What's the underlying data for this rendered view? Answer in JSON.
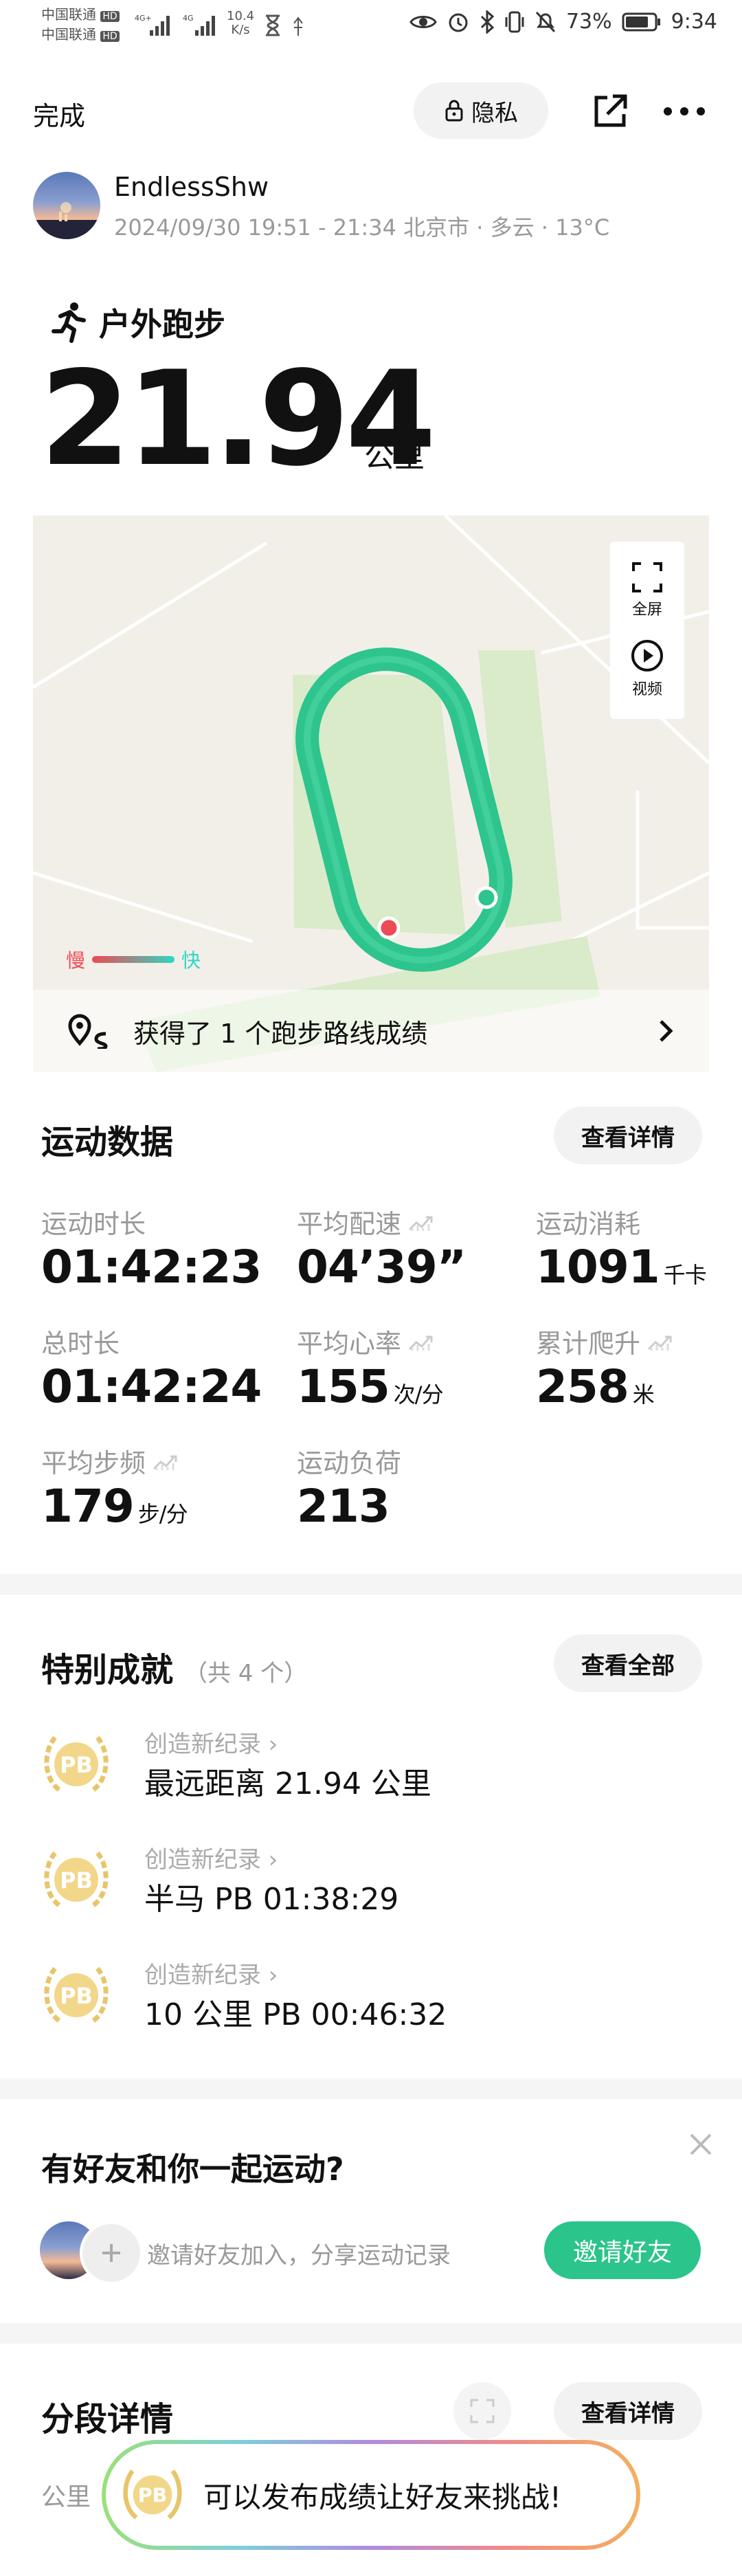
{
  "status_bar": {
    "carrier1": "中国联通",
    "carrier1_badge": "HD",
    "carrier2": "中国联通",
    "carrier2_badge": "HD",
    "net_speed": "10.4",
    "net_unit": "K/s",
    "battery": "73%",
    "time": "9:34"
  },
  "header": {
    "done_label": "完成",
    "privacy_label": "隐私"
  },
  "user": {
    "name": "EndlessShw",
    "meta": "2024/09/30 19:51 - 21:34 北京市 · 多云 · 13°C"
  },
  "activity": {
    "type": "户外跑步",
    "distance": "21.94",
    "unit": "公里"
  },
  "map": {
    "fullscreen_label": "全屏",
    "video_label": "视频",
    "legend_slow": "慢",
    "legend_fast": "快",
    "route_achievement": "获得了 1 个跑步路线成绩",
    "track_color": "#2ec48e",
    "field_color": "#d9ebc9"
  },
  "sport_data": {
    "title": "运动数据",
    "details_label": "查看详情",
    "stats": [
      {
        "label": "运动时长",
        "value": "01:42:23",
        "unit": "",
        "trend": false
      },
      {
        "label": "平均配速",
        "value": "04’39”",
        "unit": "",
        "trend": true
      },
      {
        "label": "运动消耗",
        "value": "1091",
        "unit": "千卡",
        "trend": false
      },
      {
        "label": "总时长",
        "value": "01:42:24",
        "unit": "",
        "trend": false
      },
      {
        "label": "平均心率",
        "value": "155",
        "unit": "次/分",
        "trend": true
      },
      {
        "label": "累计爬升",
        "value": "258",
        "unit": "米",
        "trend": true
      },
      {
        "label": "平均步频",
        "value": "179",
        "unit": "步/分",
        "trend": true
      },
      {
        "label": "运动负荷",
        "value": "213",
        "unit": "",
        "trend": false
      }
    ]
  },
  "achievements": {
    "title": "特别成就",
    "count": "（共 4 个）",
    "all_label": "查看全部",
    "items": [
      {
        "sub": "创造新纪录",
        "main": "最远距离 21.94 公里",
        "badge": "PB"
      },
      {
        "sub": "创造新纪录",
        "main": "半马 PB 01:38:29",
        "badge": "PB"
      },
      {
        "sub": "创造新纪录",
        "main": "10 公里 PB 00:46:32",
        "badge": "PB"
      }
    ]
  },
  "friends": {
    "title": "有好友和你一起运动?",
    "invite_text": "邀请好友加入，分享运动记录",
    "invite_button": "邀请好友"
  },
  "splits": {
    "title": "分段详情",
    "details_label": "查看详情",
    "column": "公里"
  },
  "toast": {
    "badge": "PB",
    "text": "可以发布成绩让好友来挑战!"
  },
  "colors": {
    "accent": "#2bc48a",
    "muted_text": "#999999",
    "medal_gold": "#e8c56a",
    "slow": "#ee4a55",
    "fast": "#2fd6c2"
  }
}
